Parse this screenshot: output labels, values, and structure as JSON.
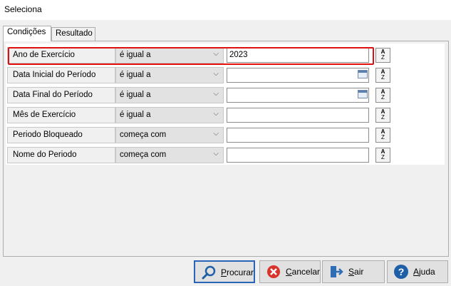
{
  "window": {
    "title": "Seleciona"
  },
  "tabs": [
    {
      "label": "Condições",
      "active": true
    },
    {
      "label": "Resultado",
      "active": false
    }
  ],
  "conditions": [
    {
      "field": "Ano de Exercício",
      "operator": "é igual a",
      "value": "2023",
      "has_calendar": false,
      "highlighted": true
    },
    {
      "field": "Data Inicial do Período",
      "operator": "é igual a",
      "value": "",
      "has_calendar": true,
      "highlighted": false
    },
    {
      "field": "Data Final do Período",
      "operator": "é igual a",
      "value": "",
      "has_calendar": true,
      "highlighted": false
    },
    {
      "field": "Mês de Exercício",
      "operator": "é igual a",
      "value": "",
      "has_calendar": false,
      "highlighted": false
    },
    {
      "field": "Periodo Bloqueado",
      "operator": "começa com",
      "value": "",
      "has_calendar": false,
      "highlighted": false
    },
    {
      "field": "Nome do Periodo",
      "operator": "começa com",
      "value": "",
      "has_calendar": false,
      "highlighted": false
    }
  ],
  "sort_button": {
    "top": "A",
    "bottom": "Z"
  },
  "buttons": {
    "search": {
      "mnemonic": "P",
      "rest": "rocurar",
      "icon": "search-icon"
    },
    "cancel": {
      "mnemonic": "C",
      "rest": "ancelar",
      "icon": "cancel-icon"
    },
    "exit": {
      "mnemonic": "S",
      "rest": "air",
      "icon": "exit-icon"
    },
    "help": {
      "mnemonic": "A",
      "rest": "juda",
      "icon": "help-icon"
    }
  },
  "colors": {
    "highlight": "#e01010",
    "primary_border": "#2a64b8"
  }
}
